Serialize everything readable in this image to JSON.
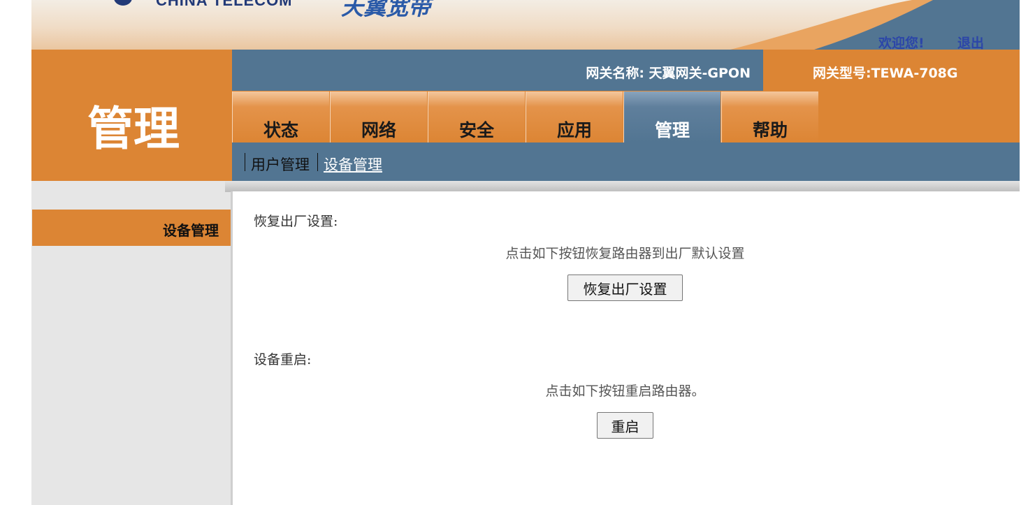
{
  "header": {
    "brand_en": "CHINA TELECOM",
    "brand_cn": "天翼宽带",
    "welcome": "欢迎您!",
    "logout": "退出"
  },
  "page_title": "管理",
  "gateway": {
    "name": "网关名称:  天翼网关-GPON",
    "model": "网关型号:TEWA-708G"
  },
  "tabs": [
    {
      "label": "状态"
    },
    {
      "label": "网络"
    },
    {
      "label": "安全"
    },
    {
      "label": "应用"
    },
    {
      "label": "管理"
    },
    {
      "label": "帮助"
    }
  ],
  "active_tab": "管理",
  "subnav": [
    {
      "label": "用户管理"
    },
    {
      "label": "设备管理"
    }
  ],
  "sidebar": {
    "items": [
      {
        "label": "设备管理"
      }
    ]
  },
  "factory_reset": {
    "title": "恢复出厂设置:",
    "description": "点击如下按钮恢复路由器到出厂默认设置",
    "button": "恢复出厂设置"
  },
  "reboot": {
    "title": "设备重启:",
    "description": "点击如下按钮重启路由器。",
    "button": "重启"
  },
  "colors": {
    "orange": "#dc8534",
    "steel_blue": "#527592",
    "link_blue": "#2c46a8"
  }
}
